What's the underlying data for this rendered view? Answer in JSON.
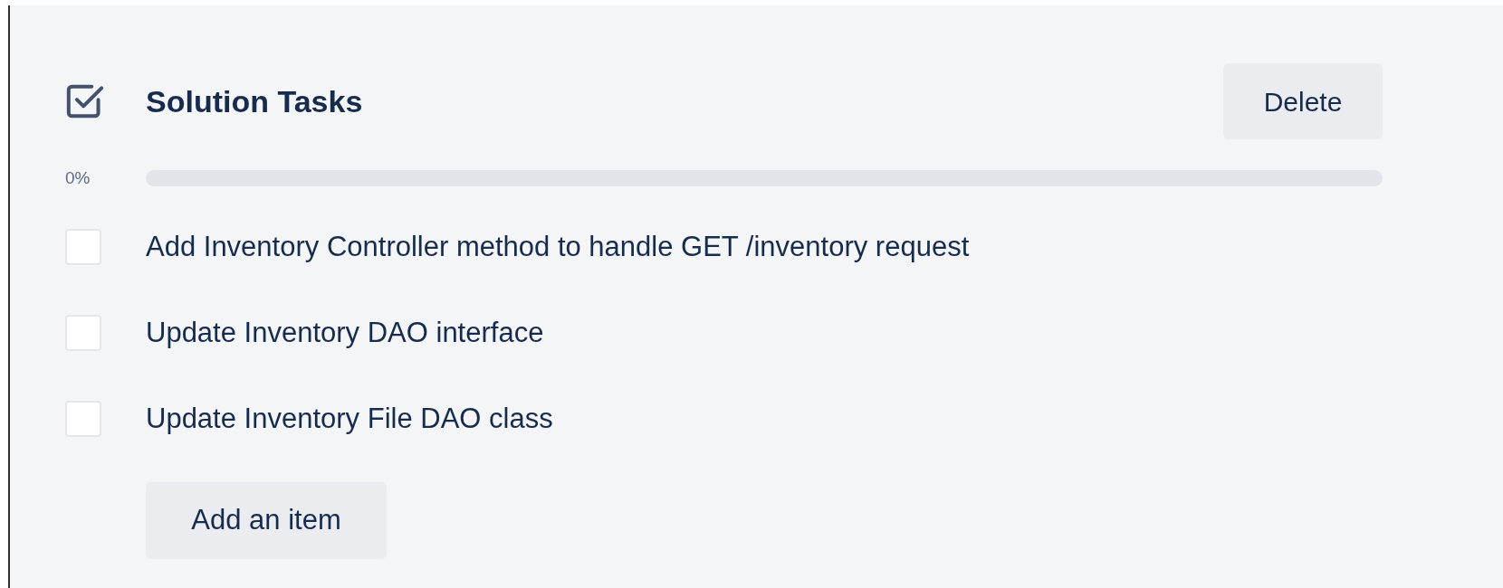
{
  "checklist": {
    "title": "Solution Tasks",
    "delete_button": "Delete",
    "progress": {
      "reading": "0%",
      "level": 0
    },
    "items": [
      {
        "label": "Add Inventory Controller method to handle GET /inventory request",
        "checked": false
      },
      {
        "label": "Update Inventory DAO interface",
        "checked": false
      },
      {
        "label": "Update Inventory File DAO class",
        "checked": false
      }
    ],
    "add_button": "Add an item"
  }
}
